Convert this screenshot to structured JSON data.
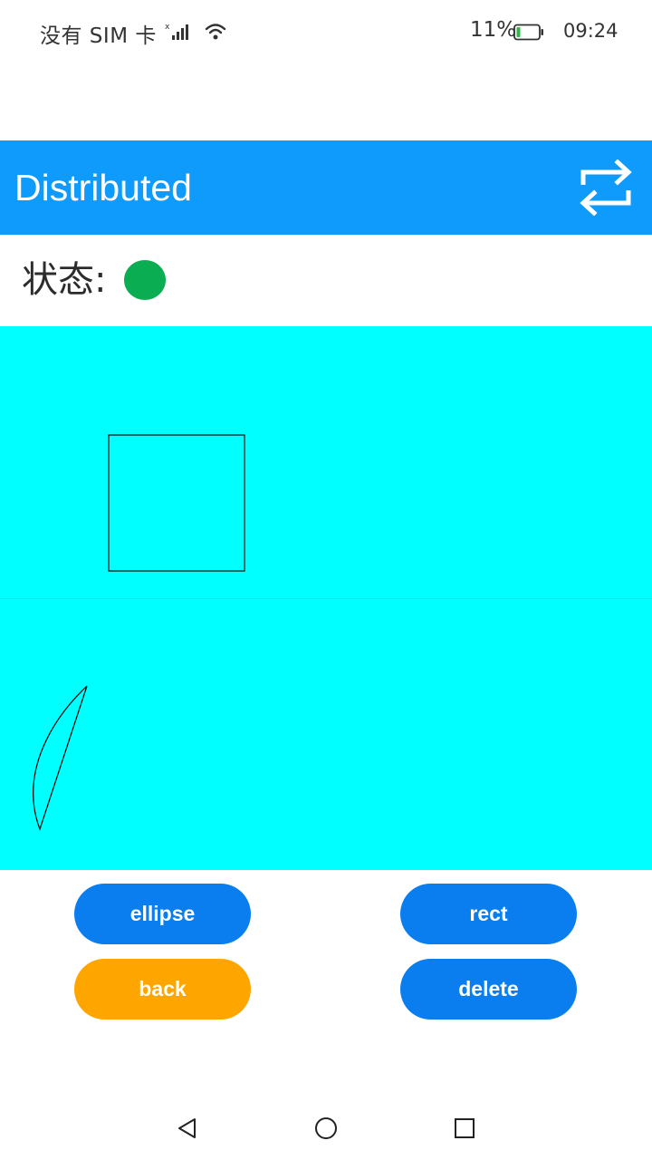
{
  "status_bar": {
    "carrier": "没有 SIM 卡",
    "battery_percent": "11%",
    "time": "09:24",
    "signal_icon": "signal-icon",
    "wifi_icon": "wifi-icon",
    "battery_icon": "battery-icon"
  },
  "header": {
    "title": "Distributed",
    "switch_icon": "switch-arrows-icon",
    "background_color": "#0f9bfc"
  },
  "status": {
    "label": "状态:",
    "indicator_color": "#0aad52"
  },
  "canvas": {
    "background_color": "#00ffff",
    "shapes": [
      "rect",
      "ellipse-arc"
    ]
  },
  "buttons": {
    "ellipse": "ellipse",
    "rect": "rect",
    "back": "back",
    "delete": "delete",
    "primary_color": "#0a7eee",
    "secondary_color": "#ffa500"
  },
  "nav_bar": {
    "back_icon": "triangle-back-icon",
    "home_icon": "circle-home-icon",
    "recent_icon": "square-recent-icon"
  }
}
